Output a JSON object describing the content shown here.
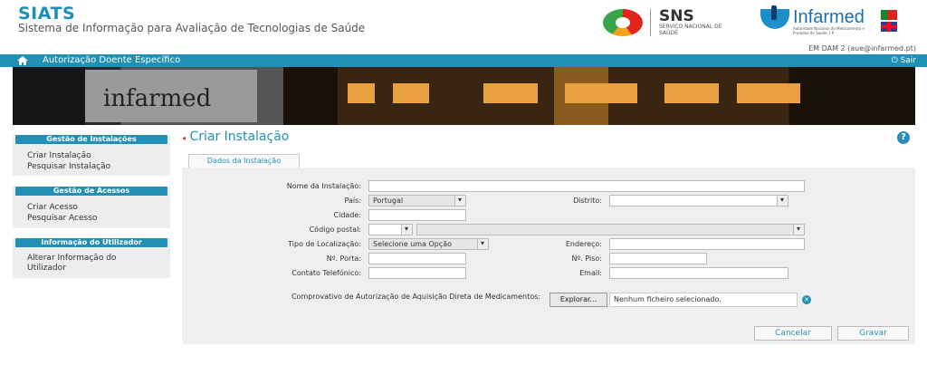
{
  "header": {
    "app_title": "SIATS",
    "app_subtitle": "Sistema de Informação para Avaliação de Tecnologias de Saúde",
    "sns_name": "SNS",
    "sns_sub": "SERVIÇO NACIONAL DE SAÚDE",
    "infarmed_name": "Infarmed",
    "infarmed_sub": "Autoridade Nacional do Medicamento e Produtos de Saúde, I.P.",
    "user": "EM DAM 2 (aue@infarmed.pt)"
  },
  "navbar": {
    "title": "Autorização Doente Específico",
    "logout": "Sair"
  },
  "banner": {
    "text": "infarmed"
  },
  "sidebar": [
    {
      "title": "Gestão de Instalações",
      "items": [
        "Criar Instalação",
        "Pesquisar Instalação"
      ]
    },
    {
      "title": "Gestão de Acessos",
      "items": [
        "Criar Acesso",
        "Pesquisar Acesso"
      ]
    },
    {
      "title": "Informação do Utilizador",
      "items": [
        "Alterar Informação do Utilizador"
      ]
    }
  ],
  "page": {
    "title": "Criar Instalação",
    "help": "?",
    "tab": "Dados da Instalação"
  },
  "form": {
    "nome_label": "Nome da Instalação:",
    "pais_label": "País:",
    "pais_value": "Portugal",
    "distrito_label": "Distrito:",
    "cidade_label": "Cidade:",
    "codigo_postal_label": "Código postal:",
    "tipo_localizacao_label": "Tipo de Localização:",
    "tipo_localizacao_value": "Selecione uma Opção",
    "endereco_label": "Endereço:",
    "porta_label": "Nº. Porta:",
    "piso_label": "Nº. Piso:",
    "contacto_label": "Contato Telefónico:",
    "email_label": "Email:",
    "comprovativo_label": "Comprovativo de Autorização de Aquisição Direta de Medicamentos:",
    "browse_label": "Explorar...",
    "file_status": "Nenhum ficheiro selecionado."
  },
  "actions": {
    "cancel": "Cancelar",
    "save": "Gravar"
  },
  "colors": {
    "accent": "#2090b5",
    "panel": "#eef0f0"
  },
  "icons": {
    "home": "home-icon",
    "logout": "power-icon",
    "help": "help-icon",
    "clear": "clear-icon"
  }
}
